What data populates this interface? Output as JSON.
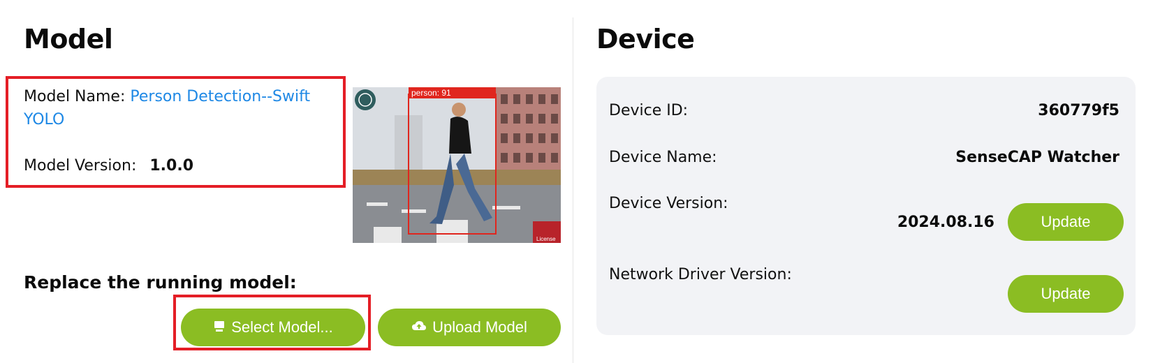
{
  "model": {
    "heading": "Model",
    "name_label": "Model Name:",
    "name_value": "Person Detection--Swift YOLO",
    "version_label": "Model Version:",
    "version_value": "1.0.0",
    "thumbnail": {
      "detection_label": "person: 91",
      "badge_text": "License"
    }
  },
  "replace": {
    "label": "Replace the running model:",
    "select_button": "Select Model...",
    "upload_button": "Upload Model"
  },
  "device": {
    "heading": "Device",
    "id_label": "Device ID:",
    "id_value": "360779f5",
    "name_label": "Device Name:",
    "name_value": "SenseCAP Watcher",
    "version_label": "Device Version:",
    "version_value": "2024.08.16",
    "update_button": "Update",
    "network_label": "Network Driver Version:",
    "network_update_button": "Update"
  },
  "colors": {
    "accent_green": "#8bbd23",
    "link_blue": "#1e88e5",
    "highlight_red": "#e41e26"
  }
}
